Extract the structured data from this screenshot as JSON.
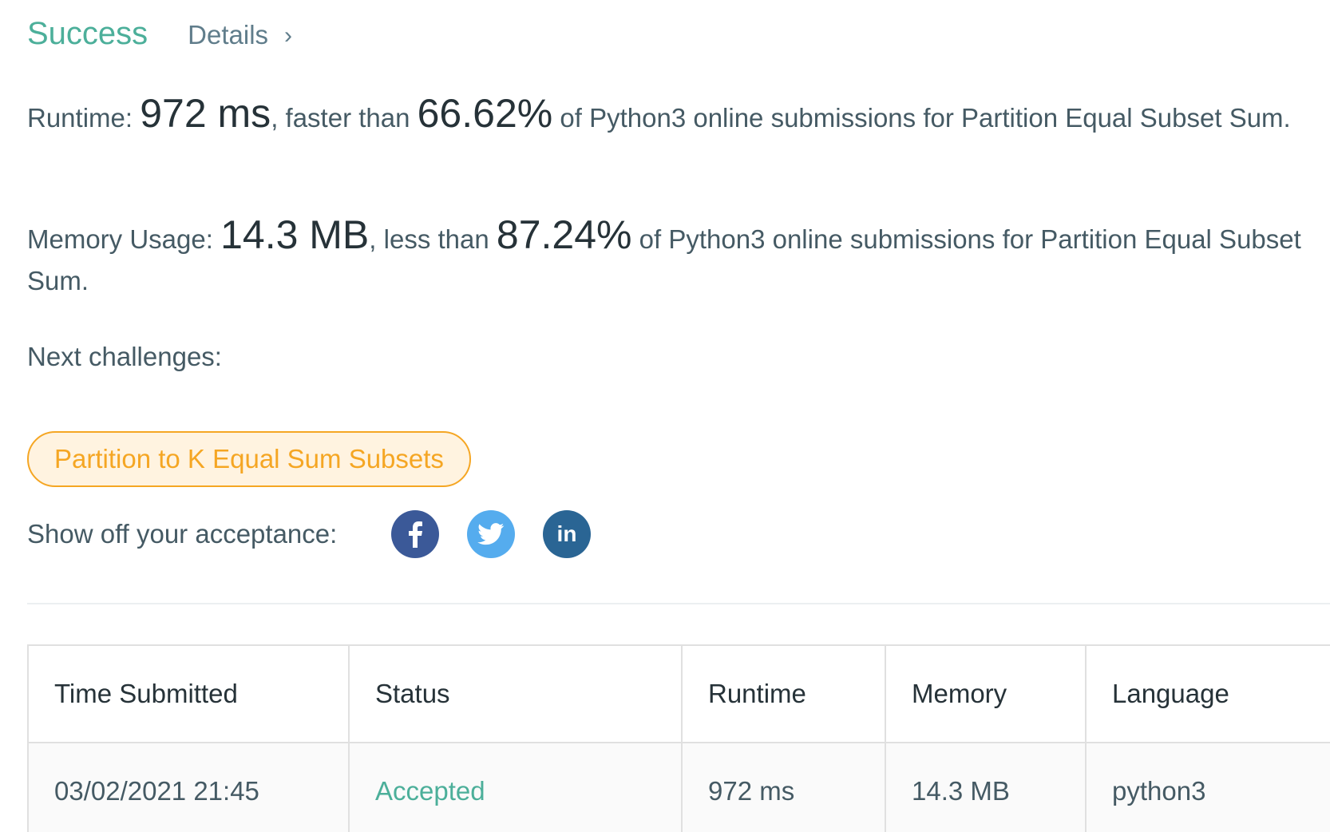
{
  "header": {
    "status_label": "Success",
    "details_label": "Details",
    "details_chevron": "›"
  },
  "runtime": {
    "label": "Runtime: ",
    "value": "972 ms",
    "comparator": ", faster than ",
    "percentile": "66.62%",
    "suffix": " of Python3 online submissions for Partition Equal Subset Sum."
  },
  "memory": {
    "label": "Memory Usage: ",
    "value": "14.3 MB",
    "comparator": ", less than ",
    "percentile": "87.24%",
    "suffix": " of Python3 online submissions for Partition Equal Subset Sum."
  },
  "next_challenges": {
    "label": "Next challenges:",
    "items": [
      {
        "label": "Partition to K Equal Sum Subsets"
      }
    ]
  },
  "share": {
    "label": "Show off your acceptance:",
    "buttons": [
      {
        "name": "facebook-icon",
        "color": "#3b5998"
      },
      {
        "name": "twitter-icon",
        "color": "#55acee"
      },
      {
        "name": "linkedin-icon",
        "color": "#0e76a8",
        "glyph": "in"
      }
    ]
  },
  "submissions_table": {
    "columns": [
      "Time Submitted",
      "Status",
      "Runtime",
      "Memory",
      "Language"
    ],
    "rows": [
      [
        "03/02/2021 21:45",
        "Accepted",
        "972 ms",
        "14.3 MB",
        "python3"
      ]
    ]
  },
  "colors": {
    "success": "#4caf9a",
    "challenge_border": "#f5a623",
    "challenge_bg": "#fff3e0"
  }
}
